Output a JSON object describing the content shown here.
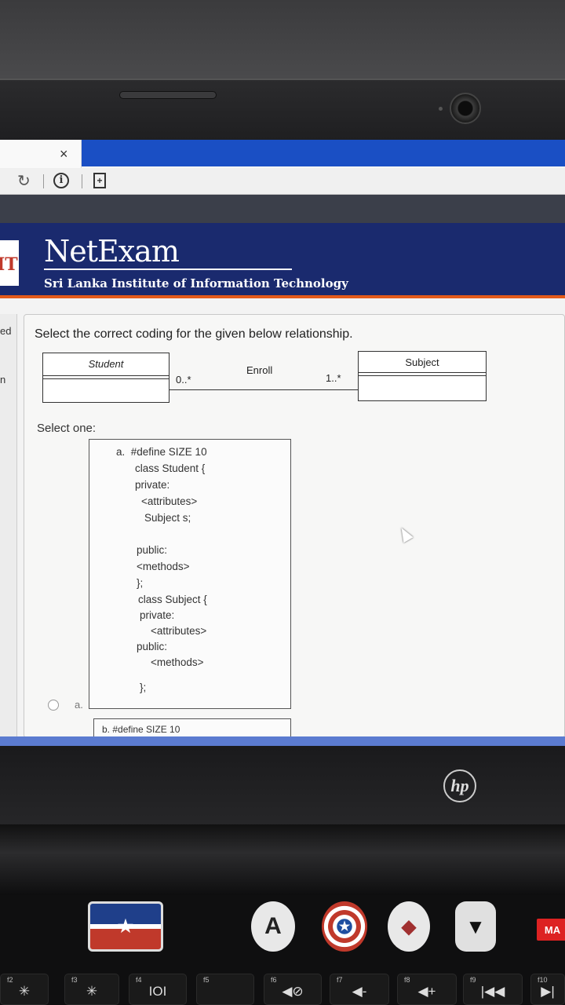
{
  "browser": {
    "tab_close_icon": "close-icon",
    "reload_icon": "reload-icon",
    "info_icon": "info-icon",
    "page_icon": "page-action-icon"
  },
  "banner": {
    "logo_text": "IT",
    "title": "NetExam",
    "subtitle": "Sri Lanka Institute of Information Technology"
  },
  "left_rail": {
    "fragment_1": "ed",
    "fragment_2": "n"
  },
  "question": {
    "prompt": "Select the correct coding for the given below relationship.",
    "diagram": {
      "class_left": "Student",
      "class_right": "Subject",
      "association": "Enroll",
      "mult_left": "0..*",
      "mult_right": "1..*"
    },
    "select_one": "Select one:",
    "option_a": {
      "lines": [
        "a.  #define SIZE 10",
        "class Student {",
        "private:",
        "<attributes>",
        "Subject s;",
        "public:",
        "<methods>",
        "};",
        "class Subject {",
        "private:",
        "<attributes>",
        "public:",
        "<methods>",
        "};"
      ],
      "radio_label": "a."
    },
    "option_b": {
      "first_line": "b.  #define SIZE 10"
    }
  },
  "laptop": {
    "brand": "hp",
    "fkeys": [
      {
        "fn": "f2",
        "sym": "✳"
      },
      {
        "fn": "f3",
        "sym": "✳"
      },
      {
        "fn": "f4",
        "sym": "IOI"
      },
      {
        "fn": "f5",
        "sym": ""
      },
      {
        "fn": "f6",
        "sym": "◀⊘"
      },
      {
        "fn": "f7",
        "sym": "◀-"
      },
      {
        "fn": "f8",
        "sym": "◀+"
      },
      {
        "fn": "f9",
        "sym": "|◀◀"
      },
      {
        "fn": "f10",
        "sym": "▶|"
      }
    ],
    "sticker_marvel": "MA"
  }
}
